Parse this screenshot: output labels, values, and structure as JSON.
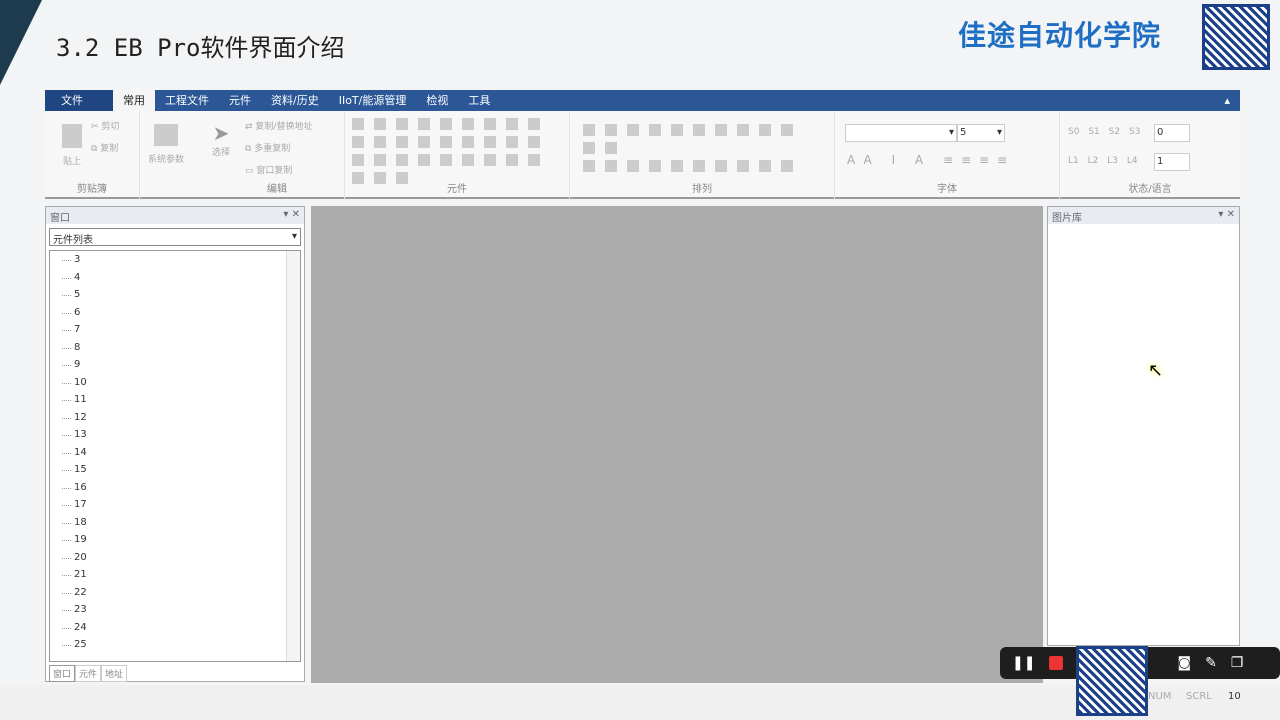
{
  "slide": {
    "title": "3.2 EB Pro软件界面介绍",
    "brand": "佳途自动化学院"
  },
  "menu": {
    "file": "文件",
    "tabs": [
      "常用",
      "工程文件",
      "元件",
      "资料/历史",
      "IIoT/能源管理",
      "检视",
      "工具"
    ]
  },
  "ribbon": {
    "clipboard": {
      "label": "剪贴簿",
      "paste": "贴上",
      "cut": "剪切",
      "copy": "复制"
    },
    "system": {
      "label": "系统参数"
    },
    "edit": {
      "label": "编辑",
      "select": "选择",
      "replace": "复制/替换地址",
      "multi_copy": "多重复制",
      "window_copy": "窗口复制"
    },
    "objects": {
      "label": "元件"
    },
    "arrange": {
      "label": "排列"
    },
    "font": {
      "label": "字体",
      "size": "5"
    },
    "state": {
      "label": "状态/语言",
      "states": [
        "S0",
        "S1",
        "S2",
        "S3"
      ],
      "state_value": "0",
      "langs": [
        "L1",
        "L2",
        "L3",
        "L4"
      ],
      "lang_value": "1"
    }
  },
  "left_panel": {
    "title": "窗口",
    "dropdown": "元件列表",
    "items": [
      "3",
      "4",
      "5",
      "6",
      "7",
      "8",
      "9",
      "10",
      "11",
      "12",
      "13",
      "14",
      "15",
      "16",
      "17",
      "18",
      "19",
      "20",
      "21",
      "22",
      "23",
      "24",
      "25"
    ],
    "tabs": [
      "窗口",
      "元件",
      "地址"
    ]
  },
  "right_panel": {
    "title": "图片库"
  },
  "statusbar": {
    "num": "NUM",
    "scrl": "SCRL",
    "value": "10"
  }
}
